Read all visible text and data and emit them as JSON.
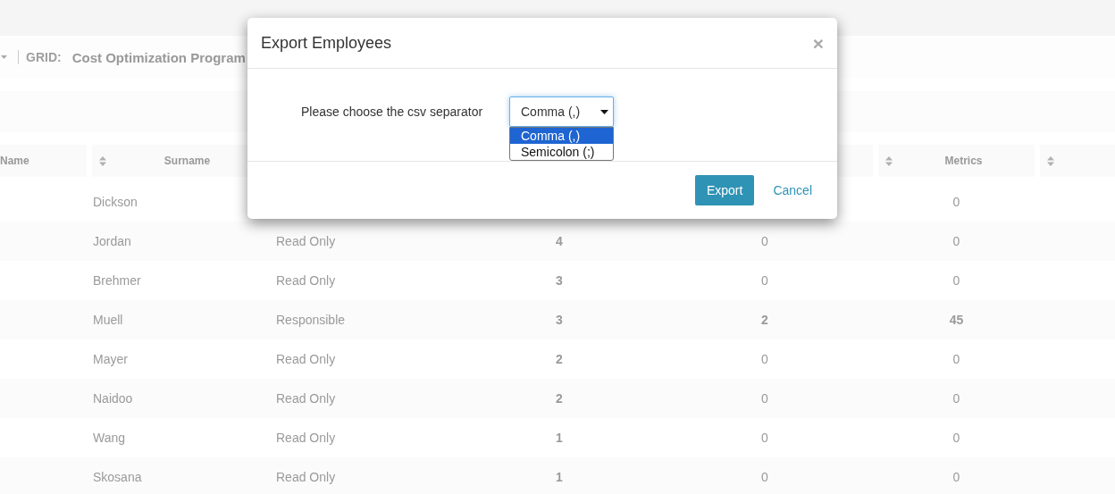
{
  "page_header": {
    "grid_label": "GRID:",
    "grid_name": "Cost Optimization Program"
  },
  "table": {
    "columns": [
      {
        "label": "Name"
      },
      {
        "label": "Surname",
        "sortable": true
      },
      {
        "label": "Metrics",
        "sortable": true
      },
      {
        "sortable": true
      }
    ],
    "rows": [
      {
        "surname": "Dickson",
        "metrics": "0"
      },
      {
        "surname": "Jordan",
        "role": "Read Only",
        "column_4": "4",
        "column_5": "0",
        "metrics": "0"
      },
      {
        "surname": "Brehmer",
        "role": "Read Only",
        "column_4": "3",
        "column_5": "0",
        "metrics": "0"
      },
      {
        "surname": "Muell",
        "role": "Responsible",
        "column_4": "3",
        "column_5": "2",
        "metrics": "45"
      },
      {
        "surname": "Mayer",
        "role": "Read Only",
        "column_4": "2",
        "column_5": "0",
        "metrics": "0"
      },
      {
        "surname": "Naidoo",
        "role": "Read Only",
        "column_4": "2",
        "column_5": "0",
        "metrics": "0"
      },
      {
        "surname": "Wang",
        "role": "Read Only",
        "column_4": "1",
        "column_5": "0",
        "metrics": "0"
      },
      {
        "surname": "Skosana",
        "role": "Read Only",
        "column_4": "1",
        "column_5": "0",
        "metrics": "0"
      }
    ]
  },
  "dialog": {
    "title": "Export Employees",
    "close": "×",
    "label": "Please choose the csv separator",
    "select": {
      "value": "Comma (,)",
      "expanded": true,
      "options": [
        {
          "label": "Comma (,)",
          "selected": true
        },
        {
          "label": "Semicolon (;)",
          "selected": false
        }
      ]
    },
    "buttons": [
      {
        "label": "Export",
        "kind": "primary"
      },
      {
        "label": "Cancel",
        "kind": "link"
      }
    ]
  }
}
